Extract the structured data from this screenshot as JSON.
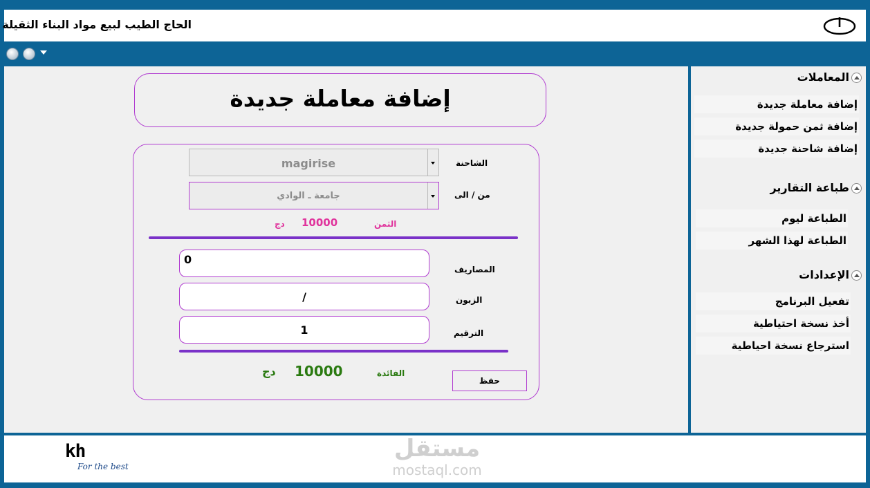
{
  "app": {
    "title": "الحاج الطيب لبيع مواد البناء الثقيلة"
  },
  "icons": {
    "power": "power-icon",
    "back": "back-arrow-icon",
    "forward": "forward-arrow-icon",
    "nav_menu": "chevron-down-icon",
    "section_toggle": "chevron-up-icon"
  },
  "main": {
    "heading": "إضافة معاملة جديدة",
    "form": {
      "truck_label": "الشاحنة",
      "truck_value": "magirise",
      "route_label": "من / الى",
      "route_value": "جامعة ـ الوادي",
      "price_label": "الثمن",
      "price_value": "10000",
      "price_currency": "دج",
      "expenses_label": "المصاريف",
      "expenses_value": "0",
      "customer_label": "الزبون",
      "customer_value": "/",
      "number_label": "الترقيم",
      "number_value": "1",
      "profit_label": "الفائدة",
      "profit_value": "10000",
      "profit_currency": "دج",
      "save_label": "حفظ"
    }
  },
  "sidebar": {
    "sections": [
      {
        "title": "المعاملات",
        "items": [
          "إضافة معاملة جديدة",
          "إضافة ثمن حمولة جديدة",
          "إضافة شاحنة جديدة"
        ]
      },
      {
        "title": "طباعة التقارير",
        "items": [
          "الطباعة ليوم",
          "الطباعة لهذا الشهر"
        ]
      },
      {
        "title": "الإعدادات",
        "items": [
          "تفعيل البرنامج",
          "أخذ نسخة احتياطية",
          "استرجاع نسخة احياطية"
        ]
      }
    ]
  },
  "footer": {
    "logo": "kh",
    "tagline": "For the best",
    "watermark_ar": "مستقل",
    "watermark_en": "mostaql.com"
  },
  "colors": {
    "frame": "#0d6496",
    "accent_border": "#b03ad0",
    "divider": "#7a32c8",
    "price": "#e0339c",
    "profit": "#2a7a10"
  }
}
